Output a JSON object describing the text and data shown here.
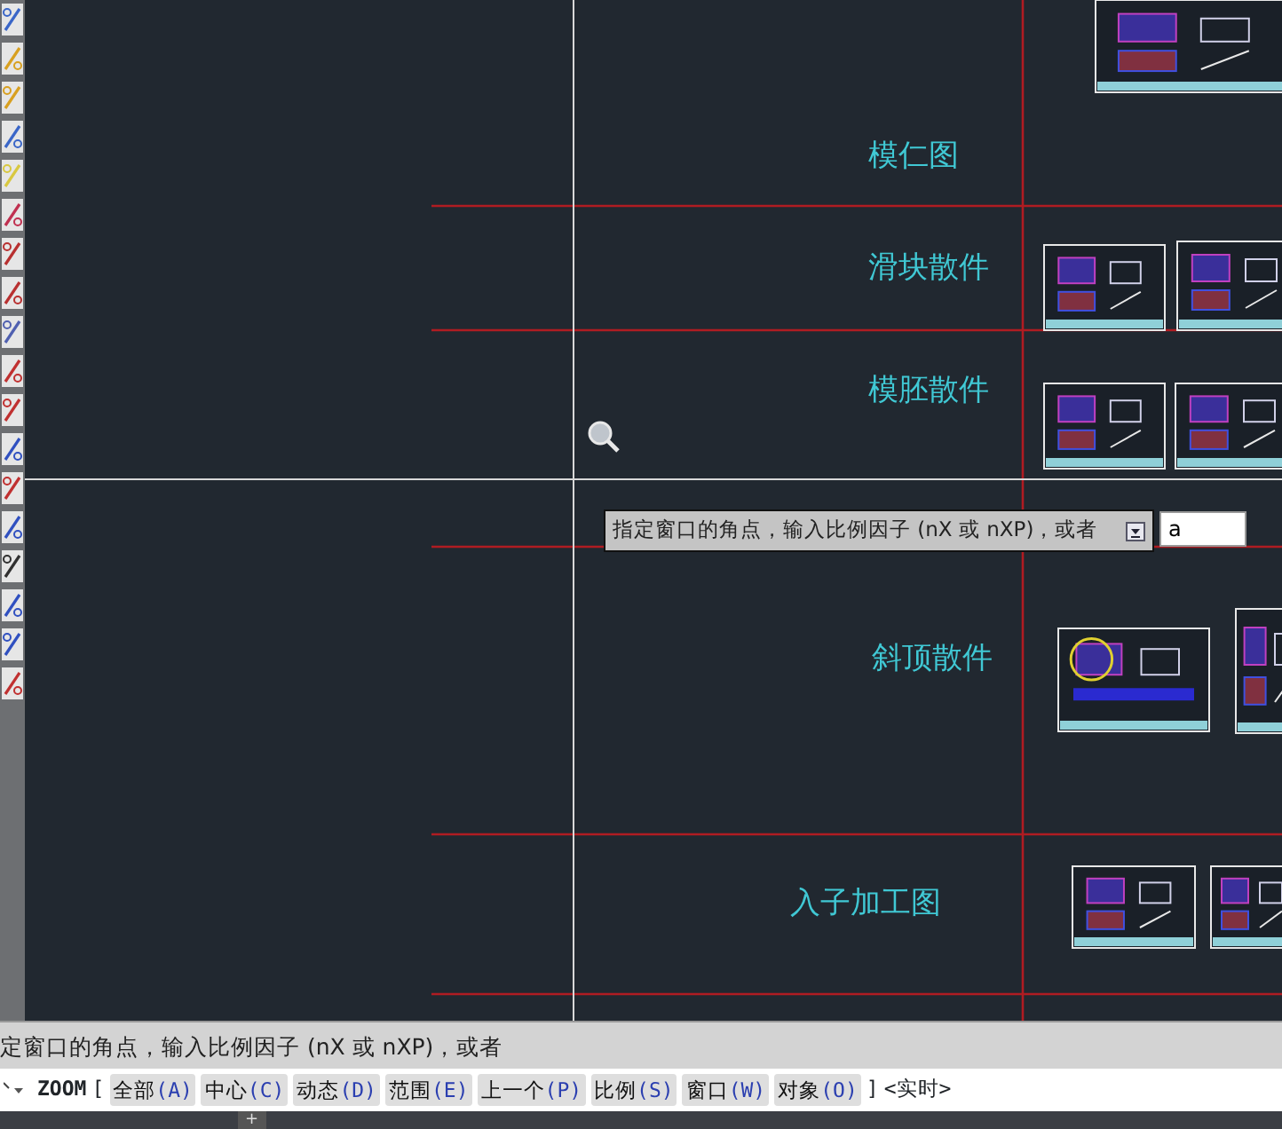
{
  "canvas": {
    "labels": [
      "模仁图",
      "滑块散件",
      "模胚散件",
      "斜顶散件",
      "入子加工图"
    ]
  },
  "tooltip": {
    "text": "指定窗口的角点，输入比例因子 (nX 或 nXP)，或者",
    "input_value": "a"
  },
  "command_history": "定窗口的角点，输入比例因子 (nX 或 nXP)，或者",
  "command_line": {
    "command": "ZOOM",
    "bracket_open": "[",
    "options": [
      {
        "label": "全部",
        "key": "(A)"
      },
      {
        "label": "中心",
        "key": "(C)"
      },
      {
        "label": "动态",
        "key": "(D)"
      },
      {
        "label": "范围",
        "key": "(E)"
      },
      {
        "label": "上一个",
        "key": "(P)"
      },
      {
        "label": "比例",
        "key": "(S)"
      },
      {
        "label": "窗口",
        "key": "(W)"
      },
      {
        "label": "对象",
        "key": "(O)"
      }
    ],
    "bracket_close": "]",
    "default": "<实时>"
  },
  "layout_tabs": [
    {
      "label": "+"
    }
  ]
}
